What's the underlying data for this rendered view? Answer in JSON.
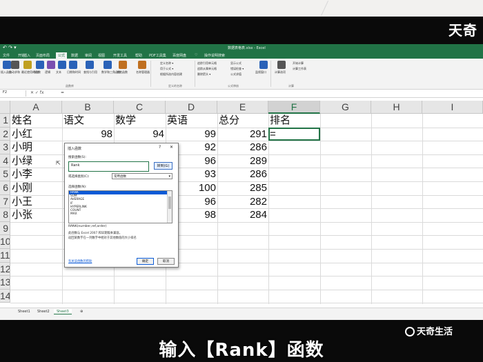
{
  "window": {
    "title": "数据表格表.xlsx - Excel",
    "brand_top": "天奇",
    "quick_access": "↶ ↷ ▾"
  },
  "menu": [
    "文件",
    "开始",
    "插入",
    "页面布局",
    "公式",
    "数据",
    "审阅",
    "视图",
    "开发工具",
    "帮助",
    "PDF工具集",
    "百度网盘",
    "♡",
    "操作说明搜索"
  ],
  "ribbon": {
    "buttons": [
      {
        "label": "插入函数",
        "color": "#2a62b8"
      },
      {
        "label": "自动求和",
        "color": "#555"
      },
      {
        "label": "最近使用的函数",
        "color": "#c0a020"
      },
      {
        "label": "财务",
        "color": "#2a62b8"
      },
      {
        "label": "逻辑",
        "color": "#7a4fb0"
      },
      {
        "label": "文本",
        "color": "#2a62b8"
      },
      {
        "label": "日期和时间",
        "color": "#2a62b8"
      },
      {
        "label": "查找与引用",
        "color": "#2a62b8"
      },
      {
        "label": "数学和三角函数",
        "color": "#2a62b8"
      },
      {
        "label": "其他函数",
        "color": "#c07020"
      },
      {
        "label": "名称管理器",
        "color": "#c07020"
      }
    ],
    "name_group": [
      "定义名称 ▾",
      "用于公式 ▾",
      "根据所选内容创建"
    ],
    "audit_group": [
      "追踪引用单元格",
      "追踪从属单元格",
      "删除箭头 ▾",
      "显示公式",
      "错误检查 ▾",
      "公式求值"
    ],
    "watch_window": "监视窗口",
    "calc": [
      "计算选项",
      "开始计算",
      "计算工作表"
    ],
    "group_labels": [
      "函数库",
      "定义的名称",
      "公式审核",
      "计算"
    ]
  },
  "formula_bar": {
    "name_box": "F2",
    "fx": "✕  ✓  fx",
    "value": "="
  },
  "columns": [
    "A",
    "B",
    "C",
    "D",
    "E",
    "F",
    "G",
    "H",
    "I"
  ],
  "rows": [
    "1",
    "2",
    "3",
    "4",
    "5",
    "6",
    "7",
    "8",
    "9",
    "10",
    "11",
    "12",
    "13",
    "14"
  ],
  "table": {
    "headers": [
      "姓名",
      "语文",
      "数学",
      "英语",
      "总分",
      "排名"
    ],
    "data": [
      {
        "name": "小红",
        "chinese": "98",
        "math": "94",
        "english": "99",
        "total": "291",
        "rank": "="
      },
      {
        "name": "小明",
        "chinese": "",
        "math": "",
        "english": "92",
        "total": "286",
        "rank": ""
      },
      {
        "name": "小绿",
        "chinese": "",
        "math": "",
        "english": "96",
        "total": "289",
        "rank": ""
      },
      {
        "name": "小李",
        "chinese": "",
        "math": "",
        "english": "93",
        "total": "286",
        "rank": ""
      },
      {
        "name": "小刚",
        "chinese": "",
        "math": "",
        "english": "100",
        "total": "285",
        "rank": ""
      },
      {
        "name": "小王",
        "chinese": "",
        "math": "",
        "english": "96",
        "total": "282",
        "rank": ""
      },
      {
        "name": "小张",
        "chinese": "",
        "math": "",
        "english": "98",
        "total": "284",
        "rank": ""
      }
    ]
  },
  "sheets": [
    "Sheet1",
    "Sheet2",
    "Sheet3"
  ],
  "sheet_add": "⊕",
  "dialog": {
    "title": "插入函数",
    "help": "?",
    "close": "✕",
    "search_label": "搜索函数(S):",
    "search_value": "Rank",
    "go_button": "转到(G)",
    "category_label": "或选择类别(C):",
    "category_value": "常用函数",
    "list_label": "选择函数(N):",
    "functions": [
      "RANK",
      "SUM",
      "AVERAGE",
      "IF",
      "HYPERLINK",
      "COUNT",
      "MAX"
    ],
    "selected_function": "RANK",
    "signature": "RANK(number,ref,order)",
    "description_1": "此函数与 Excel 2007 和早期版本兼容。",
    "description_2": "返回某数字在一列数字中相对于其他数值的大小排名",
    "help_link": "有关该函数的帮助",
    "ok": "确定",
    "cancel": "取消"
  },
  "overlay": {
    "subtitle": "输入【Rank】函数",
    "brand_bottom": "天奇生活"
  }
}
